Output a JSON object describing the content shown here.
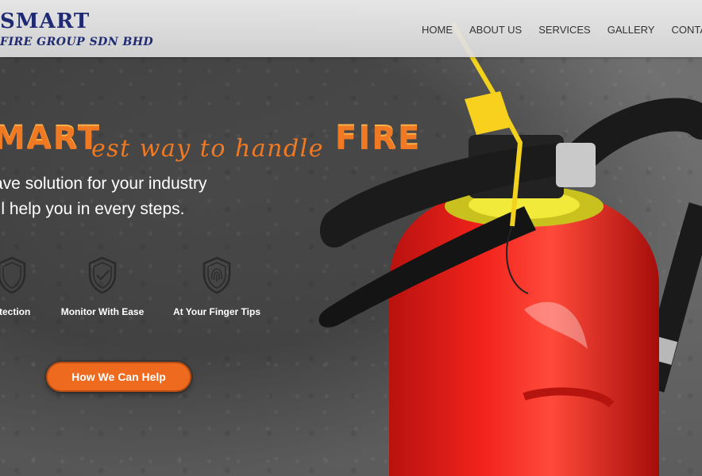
{
  "brand": {
    "line1": "SMART",
    "line2": "FIRE GROUP SDN BHD"
  },
  "nav": {
    "items": [
      {
        "label": "HOME"
      },
      {
        "label": "ABOUT US"
      },
      {
        "label": "SERVICES"
      },
      {
        "label": "GALLERY"
      },
      {
        "label": "CONTACT"
      }
    ]
  },
  "hero": {
    "headline_left": "MART",
    "headline_mid": "est way to handle",
    "headline_right": "FIRE",
    "subline1": "ave solution for your industry",
    "subline2": "ill help you in every steps."
  },
  "features": [
    {
      "label": "otection",
      "icon": "shield-icon"
    },
    {
      "label": "Monitor With Ease",
      "icon": "shield-check-icon"
    },
    {
      "label": "At Your Finger Tips",
      "icon": "shield-fingerprint-icon"
    }
  ],
  "cta": {
    "label": "How We Can Help"
  },
  "colors": {
    "accent": "#f07a23",
    "brand": "#1f2a72",
    "button": "#ee6a1e",
    "extinguisher": "#e81f1a"
  }
}
